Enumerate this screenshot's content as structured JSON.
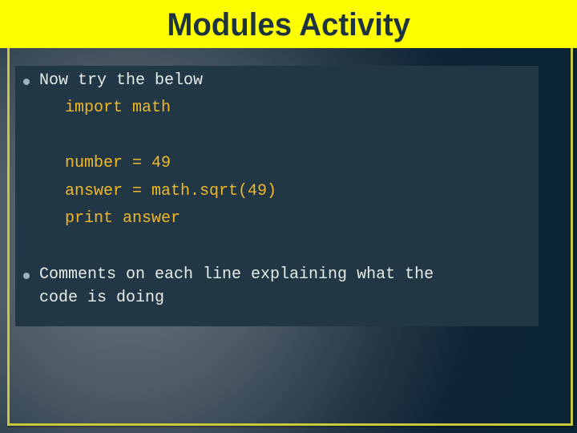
{
  "slide": {
    "title": "Modules Activity",
    "bullets": [
      {
        "text": "Now try the below",
        "code": [
          "import math",
          "",
          "number = 49",
          "answer = math.sqrt(49)",
          "print answer"
        ]
      },
      {
        "lines": [
          "Comments on each line explaining what the",
          "code is doing"
        ]
      }
    ]
  },
  "colors": {
    "title_bar": "#ffff00",
    "title_text": "#1e3340",
    "frame": "#c8c83a",
    "content_box": "#223746",
    "bullet_text": "#e6ece6",
    "code_text": "#f0b829"
  }
}
